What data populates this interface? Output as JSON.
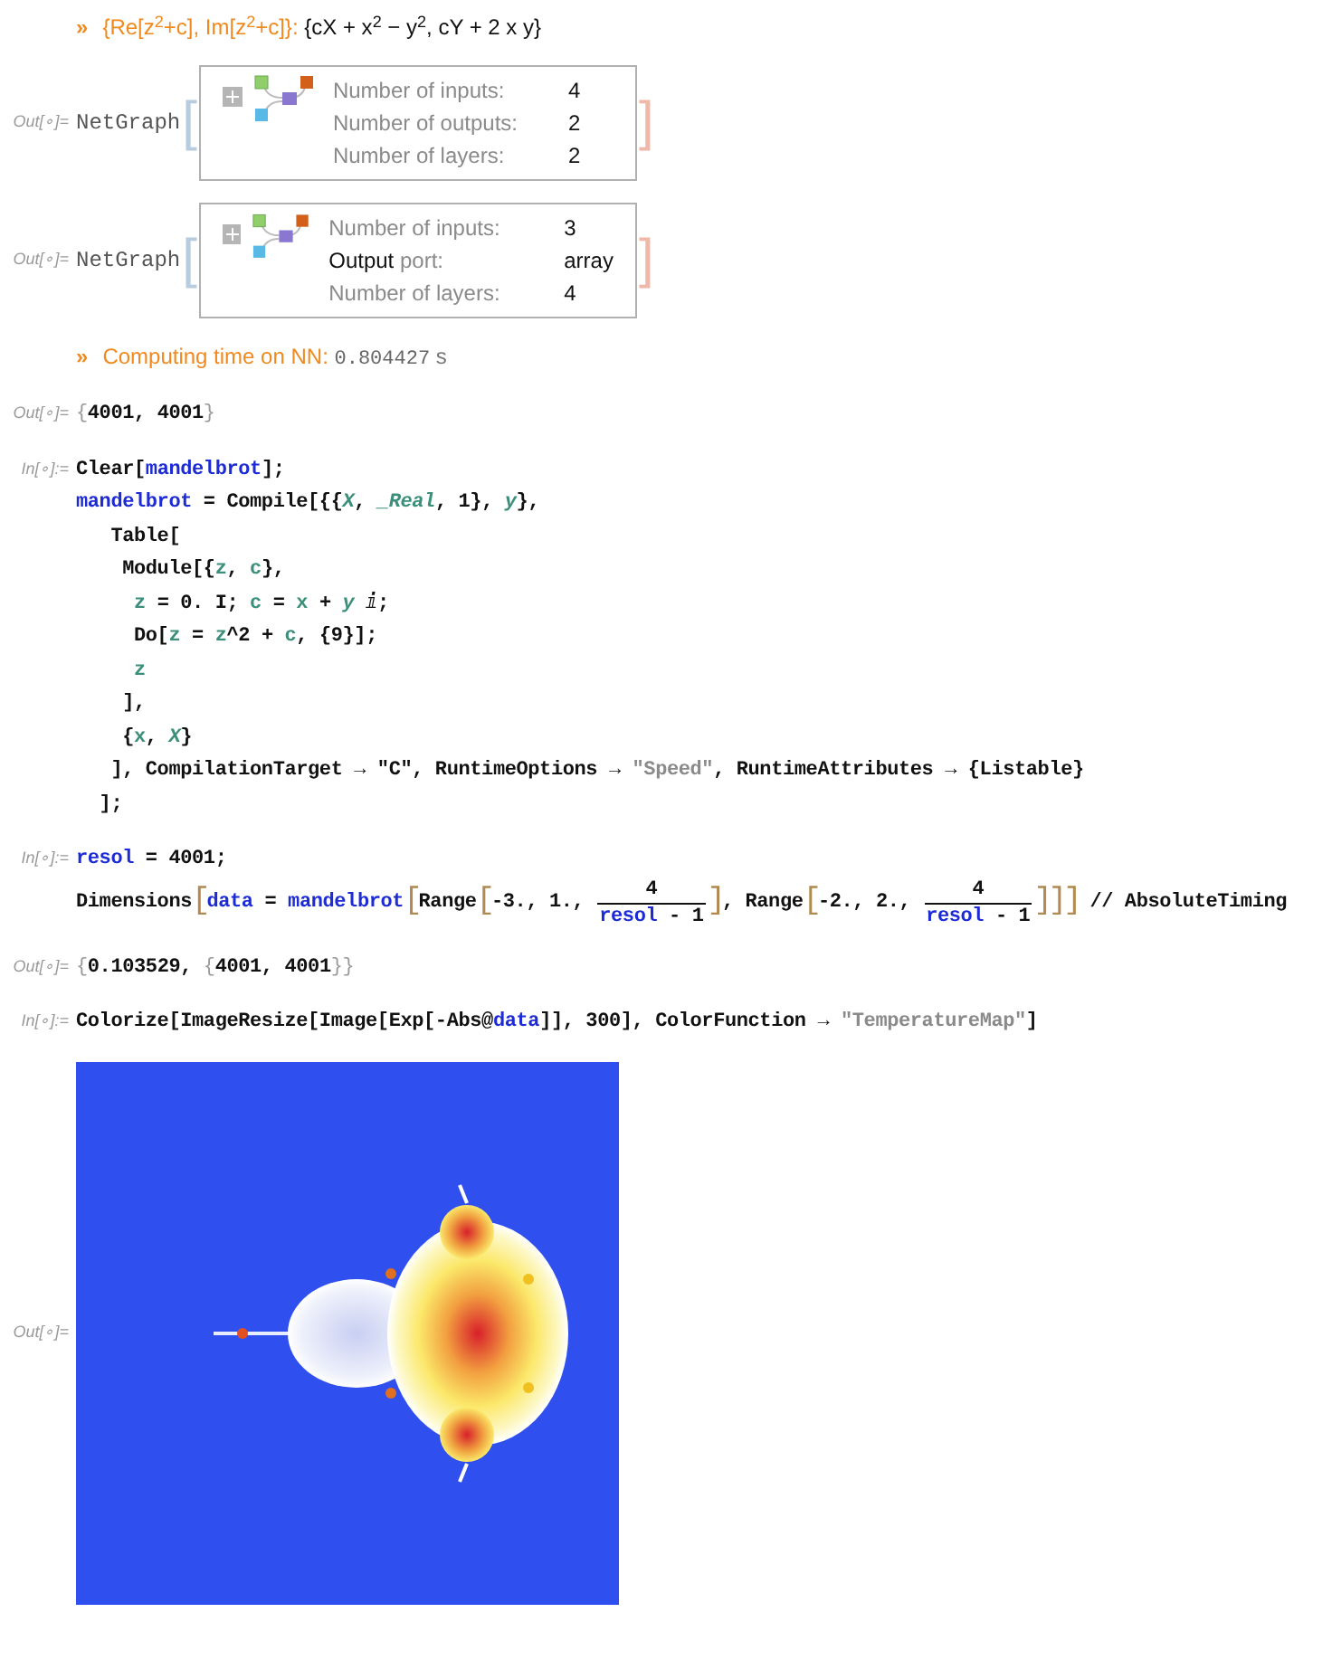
{
  "cells": [
    {
      "kind": "print",
      "marker": "»",
      "lines": [
        [
          {
            "kind": "orange",
            "text": "{Re[z$^{2}$+c], Im[z$^{2}$+c]}:"
          },
          {
            "kind": "sans",
            "text": " {cX + x$^{2}$ − y$^{2}$, cY + 2 x y}"
          }
        ]
      ]
    },
    {
      "kind": "netgraph",
      "label": "Out[∘]=",
      "head": "NetGraph",
      "open_bracket": "[",
      "close_bracket": "]",
      "rows": [
        {
          "label": "Number of inputs:",
          "value": "4"
        },
        {
          "label": "Number of outputs:",
          "value": "2"
        },
        {
          "label": "Number of layers:",
          "value": "2"
        }
      ]
    },
    {
      "kind": "netgraph",
      "label": "Out[∘]=",
      "head": "NetGraph",
      "open_bracket": "[",
      "close_bracket": "]",
      "rows": [
        {
          "label": "Number of inputs:",
          "value": "3"
        },
        {
          "strong": "Output",
          "label": " port:",
          "value": "array"
        },
        {
          "label": "Number of layers:",
          "value": "4"
        }
      ]
    },
    {
      "kind": "print",
      "marker": "»",
      "lines": [
        [
          {
            "kind": "orange",
            "text": "Computing time on NN: "
          },
          {
            "kind": "mono_gray",
            "text": "0.804427"
          },
          {
            "kind": "orange_gray",
            "text": " s"
          }
        ]
      ]
    },
    {
      "kind": "code",
      "label": "Out[∘]=",
      "lines": [
        [
          {
            "kind": "bracket",
            "text": "{"
          },
          {
            "kind": "plain",
            "text": "4001, 4001"
          },
          {
            "kind": "bracket",
            "text": "}"
          }
        ]
      ]
    },
    {
      "kind": "code",
      "label": "In[∘]:=",
      "lines": [
        [
          {
            "kind": "plain",
            "text": "Clear["
          },
          {
            "kind": "global",
            "text": "mandelbrot"
          },
          {
            "kind": "plain",
            "text": "];"
          }
        ],
        [
          {
            "kind": "global",
            "text": "mandelbrot"
          },
          {
            "kind": "plain",
            "text": " = Compile[{{"
          },
          {
            "kind": "italic",
            "text": "X"
          },
          {
            "kind": "plain",
            "text": ", "
          },
          {
            "kind": "italic",
            "text": "_Real"
          },
          {
            "kind": "plain",
            "text": ", 1}, "
          },
          {
            "kind": "italic",
            "text": "y"
          },
          {
            "kind": "plain",
            "text": "},"
          }
        ],
        [
          {
            "kind": "plain",
            "text": "   Table["
          }
        ],
        [
          {
            "kind": "plain",
            "text": "    Module[{"
          },
          {
            "kind": "local",
            "text": "z"
          },
          {
            "kind": "plain",
            "text": ", "
          },
          {
            "kind": "local",
            "text": "c"
          },
          {
            "kind": "plain",
            "text": "},"
          }
        ],
        [
          {
            "kind": "local",
            "text": "     z"
          },
          {
            "kind": "plain",
            "text": " = 0. I; "
          },
          {
            "kind": "local",
            "text": "c"
          },
          {
            "kind": "plain",
            "text": " = "
          },
          {
            "kind": "local",
            "text": "x"
          },
          {
            "kind": "plain",
            "text": " + "
          },
          {
            "kind": "italic",
            "text": "y"
          },
          {
            "kind": "plain",
            "text": " ⅈ;"
          }
        ],
        [
          {
            "kind": "plain",
            "text": "     Do["
          },
          {
            "kind": "local",
            "text": "z"
          },
          {
            "kind": "plain",
            "text": " = "
          },
          {
            "kind": "local",
            "text": "z"
          },
          {
            "kind": "plain",
            "text": "^2 + "
          },
          {
            "kind": "local",
            "text": "c"
          },
          {
            "kind": "plain",
            "text": ", {9}];"
          }
        ],
        [
          {
            "kind": "local",
            "text": "     z"
          }
        ],
        [
          {
            "kind": "plain",
            "text": "    ],"
          }
        ],
        [
          {
            "kind": "plain",
            "text": "    {"
          },
          {
            "kind": "local",
            "text": "x"
          },
          {
            "kind": "plain",
            "text": ", "
          },
          {
            "kind": "italic",
            "text": "X"
          },
          {
            "kind": "plain",
            "text": "}"
          }
        ],
        [
          {
            "kind": "plain",
            "text": "   ], CompilationTarget → \"C\", RuntimeOptions → "
          },
          {
            "kind": "string",
            "text": "\"Speed\""
          },
          {
            "kind": "plain",
            "text": ", RuntimeAttributes → {Listable}"
          }
        ],
        [
          {
            "kind": "plain",
            "text": "  ];"
          }
        ]
      ]
    },
    {
      "kind": "code",
      "label": "In[∘]:=",
      "lines": [
        [
          {
            "kind": "global",
            "text": "resol"
          },
          {
            "kind": "plain",
            "text": " = 4001;"
          }
        ],
        [
          {
            "kind": "plain",
            "text": "Dimensions"
          },
          {
            "kind": "big",
            "text": "["
          },
          {
            "kind": "global",
            "text": "data"
          },
          {
            "kind": "plain",
            "text": " = "
          },
          {
            "kind": "global",
            "text": "mandelbrot"
          },
          {
            "kind": "big",
            "text": "["
          },
          {
            "kind": "plain",
            "text": "Range"
          },
          {
            "kind": "big",
            "text": "["
          },
          {
            "kind": "plain",
            "text": "-3., 1., "
          },
          {
            "kind": "fraction",
            "numerator": "4",
            "denominator": [
              {
                "kind": "global",
                "text": "resol"
              },
              {
                "kind": "plain",
                "text": " - 1"
              }
            ]
          },
          {
            "kind": "big",
            "text": "]"
          },
          {
            "kind": "plain",
            "text": ", Range"
          },
          {
            "kind": "big",
            "text": "["
          },
          {
            "kind": "plain",
            "text": "-2., 2., "
          },
          {
            "kind": "fraction",
            "numerator": "4",
            "denominator": [
              {
                "kind": "global",
                "text": "resol"
              },
              {
                "kind": "plain",
                "text": " - 1"
              }
            ]
          },
          {
            "kind": "big",
            "text": "]]]"
          },
          {
            "kind": "plain",
            "text": " // AbsoluteTiming"
          }
        ]
      ]
    },
    {
      "kind": "code",
      "label": "Out[∘]=",
      "lines": [
        [
          {
            "kind": "bracket",
            "text": "{"
          },
          {
            "kind": "plain",
            "text": "0.103529, "
          },
          {
            "kind": "bracket",
            "text": "{"
          },
          {
            "kind": "plain",
            "text": "4001, 4001"
          },
          {
            "kind": "bracket",
            "text": "}}"
          }
        ]
      ]
    },
    {
      "kind": "code",
      "label": "In[∘]:=",
      "lines": [
        [
          {
            "kind": "plain",
            "text": "Colorize[ImageResize[Image[Exp[-Abs@"
          },
          {
            "kind": "global",
            "text": "data"
          },
          {
            "kind": "plain",
            "text": "]], 300], ColorFunction → "
          },
          {
            "kind": "string",
            "text": "\"TemperatureMap\""
          },
          {
            "kind": "plain",
            "text": "]"
          }
        ]
      ]
    },
    {
      "kind": "image",
      "label": "Out[∘]="
    }
  ]
}
